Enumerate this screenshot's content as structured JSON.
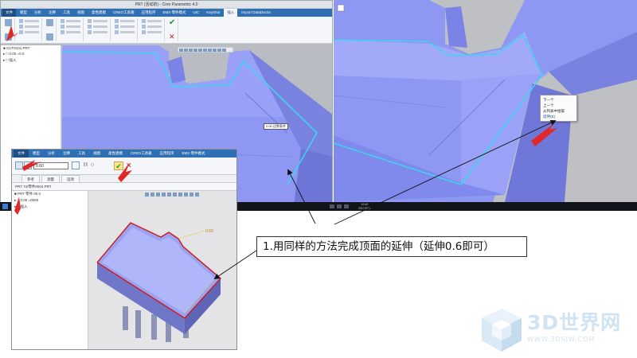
{
  "shotA": {
    "title": "PRT (活动的) - Creo Parametric 4.0",
    "menu": {
      "file": "文件",
      "items": [
        "模型",
        "分析",
        "注释",
        "工具",
        "视图",
        "柔性建模",
        "CREO工具箱",
        "应用程序",
        "EMX 零件模式",
        "UIC",
        "KeyShot",
        "插入"
      ],
      "active": "插入",
      "extra": "Import DataDoctor"
    },
    "tree_items": [
      "■ CUT0101.PRT",
      "▸ □ 0.00 =0.0",
      "▸ □ 插入"
    ],
    "dim_tag": "0.00 边界条件",
    "buttons": {
      "ok": "✔",
      "cancel": "✕"
    }
  },
  "shotB": {
    "context_menu": [
      "下一个",
      "上一个",
      "从列表中拾取",
      "延伸(E)"
    ],
    "context_highlight": "延伸(E)"
  },
  "taskbar": {
    "clock_time": "10:40",
    "clock_date": "2017/5/21"
  },
  "shotC": {
    "menu": {
      "file": "文件",
      "items": [
        "模型",
        "分析",
        "注释",
        "工具",
        "视图",
        "柔性建模",
        "CREO工具箱",
        "应用程序",
        "EMX 零件模式"
      ]
    },
    "distance_value": "0.60",
    "tabs": [
      "参考",
      "测量",
      "选项"
    ],
    "breadcrumb": "PRT 72/零件0004.PRT",
    "tree_items": [
      "■ PRT 零件 00 0",
      "▸ □ 0.00 =0000",
      "▸ □ 插入"
    ],
    "dim_label": "0.60",
    "buttons": {
      "ok": "✔",
      "cancel": "✕",
      "pause": "II ○"
    }
  },
  "callout": {
    "text": "1.用同样的方法完成顶面的延伸（延伸0.6即可）"
  },
  "watermark": {
    "brand": "3D世界网",
    "url": "WWW.3DSJW.COM"
  },
  "colors": {
    "model_blue": "#8a93f0",
    "model_face": "#9aa2f7",
    "selection_cyan": "#3fd3f0",
    "arrow_red": "#e02828",
    "outline_red": "#d01616",
    "app_blue": "#2f6fb3"
  }
}
